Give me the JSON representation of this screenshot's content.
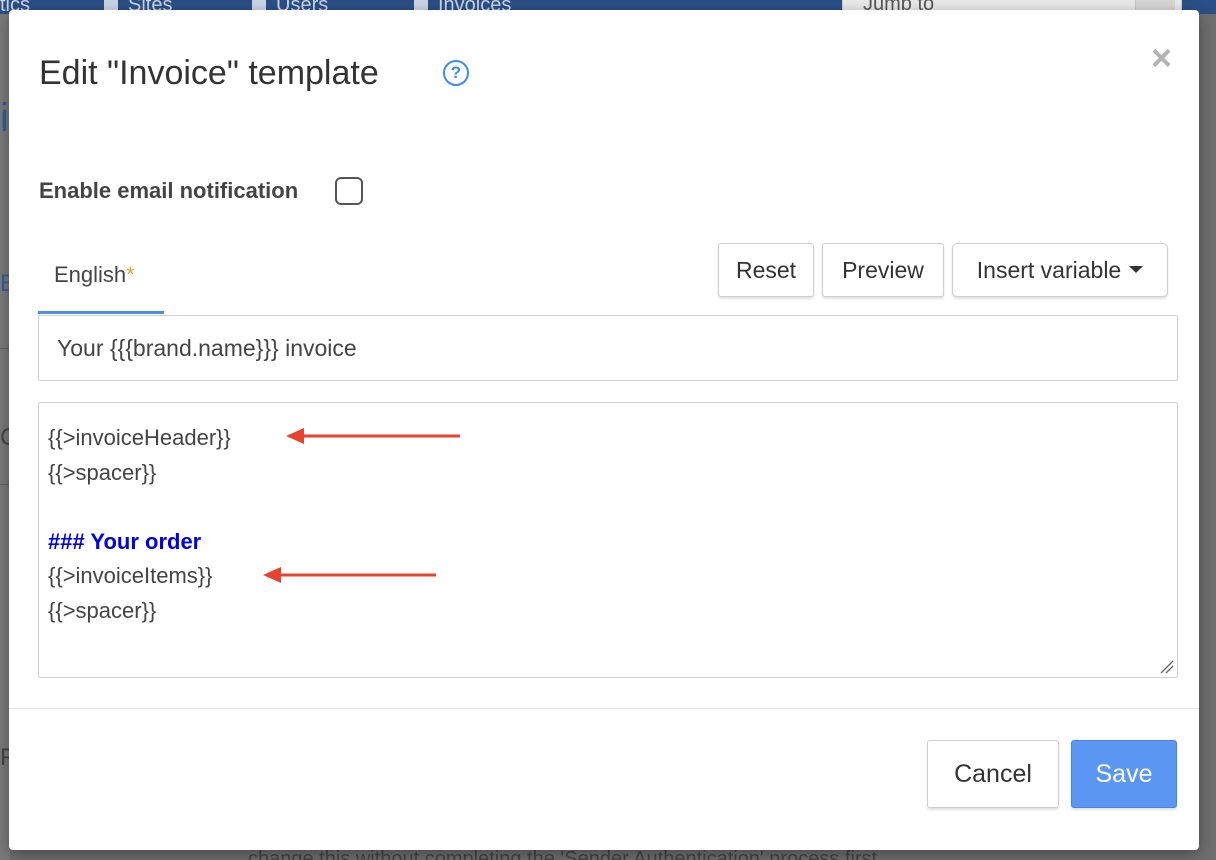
{
  "background": {
    "nav_items": [
      "tics",
      "Sites",
      "Users",
      "Invoices"
    ],
    "jump_placeholder": "Jump to",
    "left_glyphs": [
      "i",
      "E",
      "C",
      "Fi"
    ],
    "footer_text": "change this without completing the 'Sender Authentication' process first."
  },
  "modal": {
    "title": "Edit \"Invoice\" template",
    "help_icon": "question-circle-icon",
    "close_icon": "×",
    "notification_label": "Enable email notification",
    "notification_checked": false,
    "tab_label": "English",
    "tab_required_mark": "*",
    "toolbar": {
      "reset_label": "Reset",
      "preview_label": "Preview",
      "insert_variable_label": "Insert variable"
    },
    "subject_value": "Your {{{brand.name}}} invoice",
    "body_lines": [
      "{{>invoiceHeader}}",
      "{{>spacer}}",
      "",
      "### Your order",
      "{{>invoiceItems}}",
      "{{>spacer}}"
    ],
    "cancel_label": "Cancel",
    "save_label": "Save"
  },
  "colors": {
    "accent": "#3a8ee6",
    "save_button": "#5b96f2",
    "tab_underline": "#4a90e2",
    "required_mark": "#e0a33b",
    "heading_text": "#0000e0",
    "annotation_arrow": "#e8432e"
  }
}
